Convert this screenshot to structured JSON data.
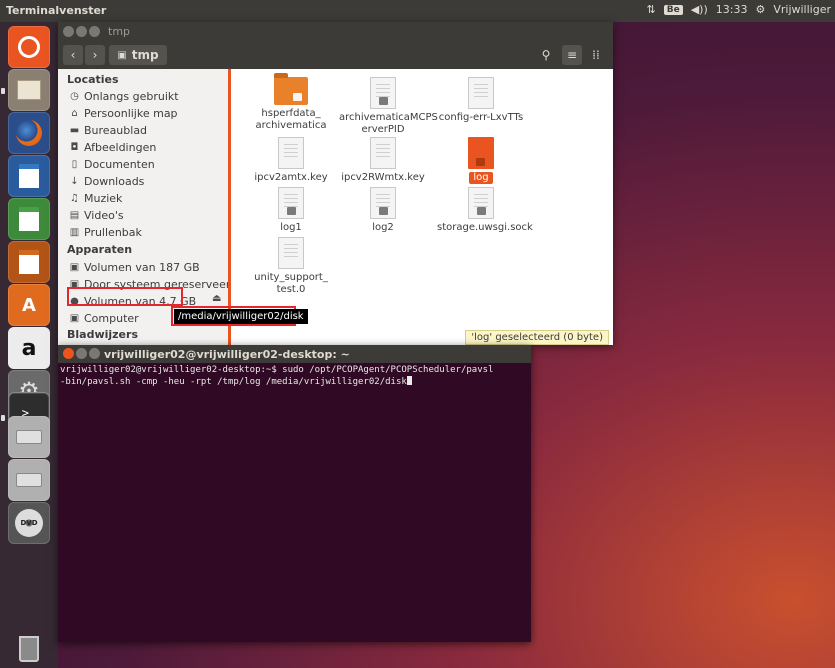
{
  "top_panel": {
    "title": "Terminalvenster",
    "keyboard_badge": "Be",
    "time": "13:33",
    "user": "Vrijwilliger"
  },
  "launcher": {
    "items": [
      {
        "name": "ubuntu-dash",
        "icon": "ubuntu-logo-icon"
      },
      {
        "name": "files",
        "icon": "file-cabinet-icon"
      },
      {
        "name": "firefox",
        "icon": "firefox-icon"
      },
      {
        "name": "libreoffice-writer",
        "icon": "writer-icon"
      },
      {
        "name": "libreoffice-calc",
        "icon": "calc-icon"
      },
      {
        "name": "libreoffice-impress",
        "icon": "impress-icon"
      },
      {
        "name": "software-center",
        "icon": "software-center-icon"
      },
      {
        "name": "amazon",
        "icon": "amazon-icon"
      },
      {
        "name": "system-settings",
        "icon": "settings-icon"
      },
      {
        "name": "terminal",
        "icon": "terminal-icon"
      },
      {
        "name": "drive-1",
        "icon": "drive-icon"
      },
      {
        "name": "drive-2",
        "icon": "drive-icon"
      },
      {
        "name": "dvd",
        "icon": "dvd-icon"
      },
      {
        "name": "trash",
        "icon": "trash-icon"
      }
    ],
    "amazon_glyph": "a",
    "dvd_glyph": "DVD"
  },
  "nautilus": {
    "window_title": "tmp",
    "path_button": "tmp",
    "sidebar": {
      "locaties_heading": "Locaties",
      "locaties": [
        {
          "label": "Onlangs gebruikt",
          "icon": "clock-icon",
          "glyph": "◷"
        },
        {
          "label": "Persoonlijke map",
          "icon": "home-icon",
          "glyph": "⌂"
        },
        {
          "label": "Bureaublad",
          "icon": "desktop-folder-icon",
          "glyph": "▬"
        },
        {
          "label": "Afbeeldingen",
          "icon": "camera-icon",
          "glyph": "◘"
        },
        {
          "label": "Documenten",
          "icon": "document-icon",
          "glyph": "▯"
        },
        {
          "label": "Downloads",
          "icon": "download-icon",
          "glyph": "↓"
        },
        {
          "label": "Muziek",
          "icon": "music-icon",
          "glyph": "♫"
        },
        {
          "label": "Video's",
          "icon": "film-icon",
          "glyph": "▤"
        },
        {
          "label": "Prullenbak",
          "icon": "trash-icon",
          "glyph": "▥"
        }
      ],
      "apparaten_heading": "Apparaten",
      "apparaten": [
        {
          "label": "Volumen van 187 GB",
          "icon": "drive-icon",
          "glyph": "▣"
        },
        {
          "label": "Door systeem gereserveerd",
          "icon": "drive-icon",
          "glyph": "▣"
        },
        {
          "label": "Volumen van 4,7 GB",
          "icon": "disc-icon",
          "glyph": "●"
        },
        {
          "label": "Computer",
          "icon": "computer-icon",
          "glyph": "▣"
        }
      ],
      "bladwijzers_heading": "Bladwijzers"
    },
    "files": [
      {
        "name": "hsperfdata_\narchivematica",
        "type": "folder"
      },
      {
        "name": "archivematicaMCPS\nerverPID",
        "type": "doc-locked"
      },
      {
        "name": "config-err-LxvTTs",
        "type": "doc"
      },
      {
        "name": "ipcv2amtx.key",
        "type": "doc"
      },
      {
        "name": "ipcv2RWmtx.key",
        "type": "doc"
      },
      {
        "name": "log",
        "type": "orange-locked"
      },
      {
        "name": "log1",
        "type": "doc-locked"
      },
      {
        "name": "log2",
        "type": "doc-locked"
      },
      {
        "name": "storage.uwsgi.sock",
        "type": "doc-locked"
      },
      {
        "name": "unity_support_\ntest.0",
        "type": "doc"
      }
    ],
    "status": "'log' geselecteerd (0 byte)",
    "tooltip": "/media/vrijwilliger02/disk"
  },
  "terminal": {
    "title": "vrijwilliger02@vrijwilliger02-desktop: ~",
    "line1": "vrijwilliger02@vrijwilliger02-desktop:~$ sudo /opt/PCOPAgent/PCOPScheduler/pavsl",
    "line2": "-bin/pavsl.sh -cmp -heu -rpt /tmp/log /media/vrijwilliger02/disk"
  },
  "colors": {
    "accent": "#e95420",
    "highlight_box": "#e0282e",
    "panel": "#3c3b37",
    "terminal_bg": "#300a24"
  }
}
